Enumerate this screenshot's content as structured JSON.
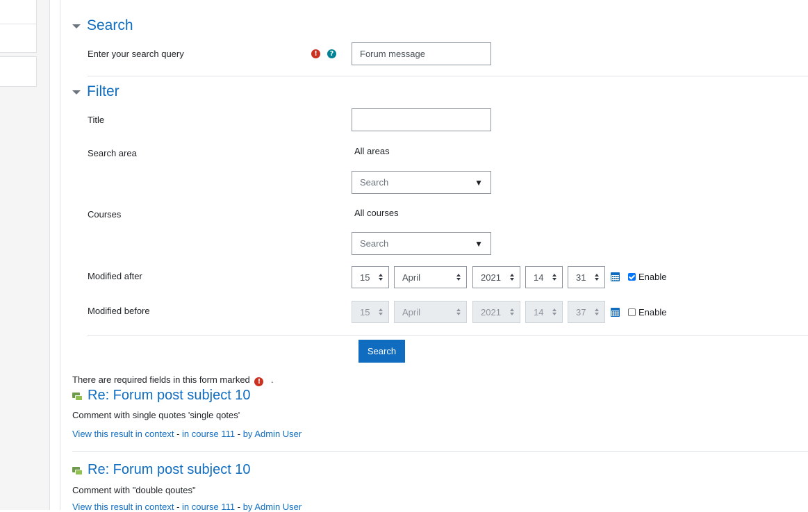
{
  "search_section": {
    "title": "Search",
    "query_label": "Enter your search query",
    "query_value": "Forum message",
    "required_icon": "exclamation-circle-icon",
    "help_icon": "question-circle-icon"
  },
  "filter_section": {
    "title": "Filter",
    "title_label": "Title",
    "title_value": "",
    "search_area_label": "Search area",
    "search_area_selected": "All areas",
    "search_area_placeholder": "Search",
    "courses_label": "Courses",
    "courses_selected": "All courses",
    "courses_placeholder": "Search",
    "modified_after": {
      "label": "Modified after",
      "day": "15",
      "month": "April",
      "year": "2021",
      "hour": "14",
      "minute": "31",
      "enabled": true,
      "enable_label": "Enable"
    },
    "modified_before": {
      "label": "Modified before",
      "day": "15",
      "month": "April",
      "year": "2021",
      "hour": "14",
      "minute": "37",
      "enabled": false,
      "enable_label": "Enable"
    }
  },
  "submit_label": "Search",
  "required_note": {
    "prefix": "There are required fields in this form marked",
    "suffix": "."
  },
  "results": [
    {
      "title": "Re: Forum post subject 10",
      "content": "Comment with single quotes 'single qotes'",
      "context_link": "View this result in context",
      "course_link": "in course 111",
      "user_link": "by Admin User"
    },
    {
      "title": "Re: Forum post subject 10",
      "content": "Comment with \"double qoutes\"",
      "context_link": "View this result in context",
      "course_link": "in course 111",
      "user_link": "by Admin User"
    }
  ],
  "separator": " - ",
  "colors": {
    "link": "#0f6cbf",
    "required": "#ca3120",
    "help": "#008196",
    "primary_button": "#0f6cbf"
  }
}
